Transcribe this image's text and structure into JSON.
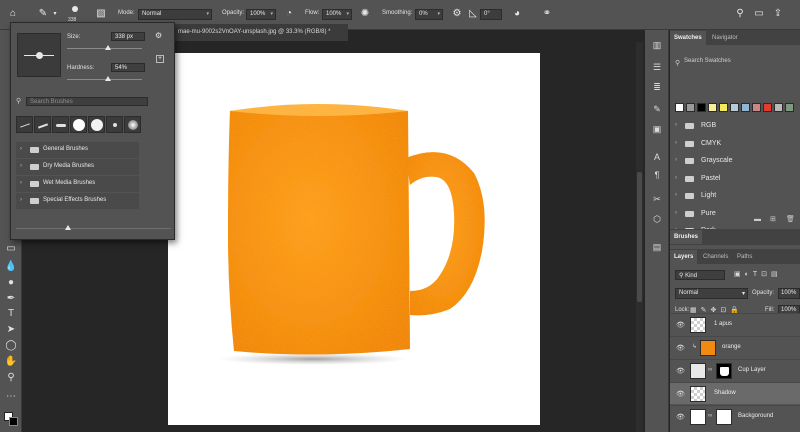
{
  "options_bar": {
    "brush_size": "338",
    "mode_label": "Mode:",
    "mode_value": "Normal",
    "opacity_label": "Opacity:",
    "opacity_value": "100%",
    "flow_label": "Flow:",
    "flow_value": "100%",
    "smoothing_label": "Smoothing:",
    "smoothing_value": "0%",
    "angle_value": "0°"
  },
  "document_tab": {
    "title": "mae-mu-9002s2VnOAY-unsplash.jpg @ 33.3% (RGB/8) *"
  },
  "brush_popup": {
    "size_label": "Size:",
    "size_value": "338 px",
    "size_slider_fraction": 0.55,
    "hardness_label": "Hardness:",
    "hardness_value": "54%",
    "hardness_fraction": 0.54,
    "search_placeholder": "Search Brushes",
    "folders": [
      {
        "label": "General Brushes"
      },
      {
        "label": "Dry Media Brushes"
      },
      {
        "label": "Wet Media Brushes"
      },
      {
        "label": "Special Effects Brushes"
      }
    ]
  },
  "swatches_panel": {
    "tabs": [
      "Swatches",
      "Navigator"
    ],
    "search_placeholder": "Search Swatches",
    "colors": [
      "#ffffff",
      "#9a9a9a",
      "#000000",
      "#f7ef9a",
      "#f5e95c",
      "#b8ccd8",
      "#93b6d0",
      "#c98686",
      "#e23b30",
      "#b9b9b9",
      "#7e9a7e"
    ],
    "folders": [
      "RGB",
      "CMYK",
      "Grayscale",
      "Pastel",
      "Light",
      "Pure",
      "Dark"
    ]
  },
  "brushes_tab": {
    "label": "Brushes"
  },
  "layers_panel": {
    "tabs": [
      "Layers",
      "Channels",
      "Paths"
    ],
    "filter_value": "Kind",
    "blend_mode": "Normal",
    "opacity_label": "Opacity:",
    "opacity_value": "100%",
    "lock_label": "Lock:",
    "fill_label": "Fill:",
    "fill_value": "100%",
    "layers": [
      {
        "name": "1 apus",
        "kind": "checker"
      },
      {
        "name": "orange",
        "kind": "orange"
      },
      {
        "name": "Cup Layer",
        "kind": "cup"
      },
      {
        "name": "Shadow",
        "kind": "checker"
      },
      {
        "name": "Backgoround",
        "kind": "white"
      }
    ]
  },
  "colors": {
    "accent_orange": "#f28a12",
    "ui_bg": "#535353",
    "workspace": "#262626"
  }
}
